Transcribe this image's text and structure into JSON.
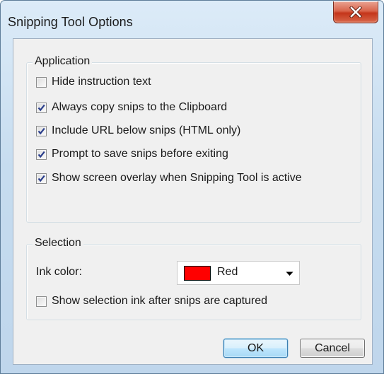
{
  "window": {
    "title": "Snipping Tool Options",
    "close_label": "x"
  },
  "application": {
    "legend": "Application",
    "options": [
      {
        "label": "Hide instruction text",
        "checked": false
      },
      {
        "label": "Always copy snips to the Clipboard",
        "checked": true
      },
      {
        "label": "Include URL below snips (HTML only)",
        "checked": true
      },
      {
        "label": "Prompt to save snips before exiting",
        "checked": true
      },
      {
        "label": "Show screen overlay when Snipping Tool is active",
        "checked": true
      }
    ]
  },
  "selection": {
    "legend": "Selection",
    "ink_label": "Ink color:",
    "ink_value": "Red",
    "ink_color": "#ff0000",
    "show_ink": {
      "label": "Show selection ink after snips are captured",
      "checked": false
    }
  },
  "buttons": {
    "ok": "OK",
    "cancel": "Cancel"
  },
  "icons": {
    "close": "close-x-icon",
    "check": "checkmark-icon",
    "dropdown": "dropdown-arrow-icon"
  }
}
